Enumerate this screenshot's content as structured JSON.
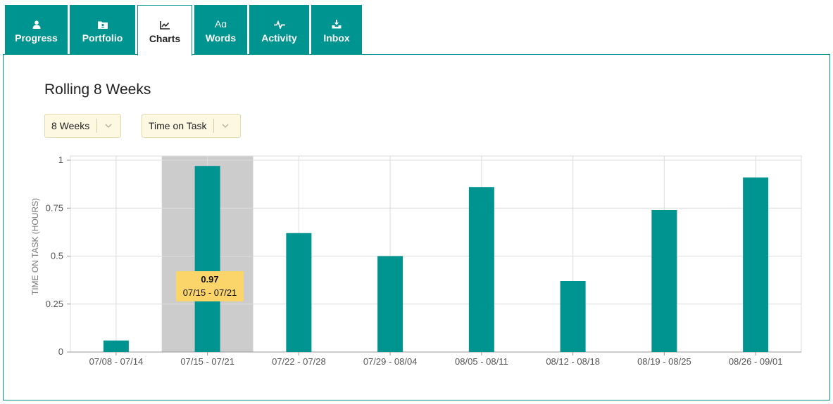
{
  "tabs": [
    {
      "label": "Progress",
      "icon": "person-icon"
    },
    {
      "label": "Portfolio",
      "icon": "folder-icon"
    },
    {
      "label": "Charts",
      "icon": "line-chart-icon"
    },
    {
      "label": "Words",
      "icon": "font-icon"
    },
    {
      "label": "Activity",
      "icon": "pulse-icon"
    },
    {
      "label": "Inbox",
      "icon": "inbox-download-icon"
    }
  ],
  "active_tab": "Charts",
  "colors": {
    "accent": "#009490",
    "highlight": "#cccccc",
    "tooltip": "#fbd46a"
  },
  "panel": {
    "title": "Rolling 8 Weeks",
    "range_select": "8 Weeks",
    "metric_select": "Time on Task"
  },
  "tooltip": {
    "value": "0.97",
    "range": "07/15 - 07/21"
  },
  "chart_data": {
    "type": "bar",
    "ylabel": "TIME ON TASK (HOURS)",
    "ylim": [
      0,
      1
    ],
    "yticks": [
      "0",
      "0.25",
      "0.5",
      "0.75",
      "1"
    ],
    "categories": [
      "07/08 - 07/14",
      "07/15 - 07/21",
      "07/22 - 07/28",
      "07/29 - 08/04",
      "08/05 - 08/11",
      "08/12 - 08/18",
      "08/19 - 08/25",
      "08/26 - 09/01"
    ],
    "values": [
      0.06,
      0.97,
      0.62,
      0.5,
      0.86,
      0.37,
      0.74,
      0.91
    ],
    "highlighted_category": "07/15 - 07/21",
    "grid": true,
    "color": "#009490"
  }
}
